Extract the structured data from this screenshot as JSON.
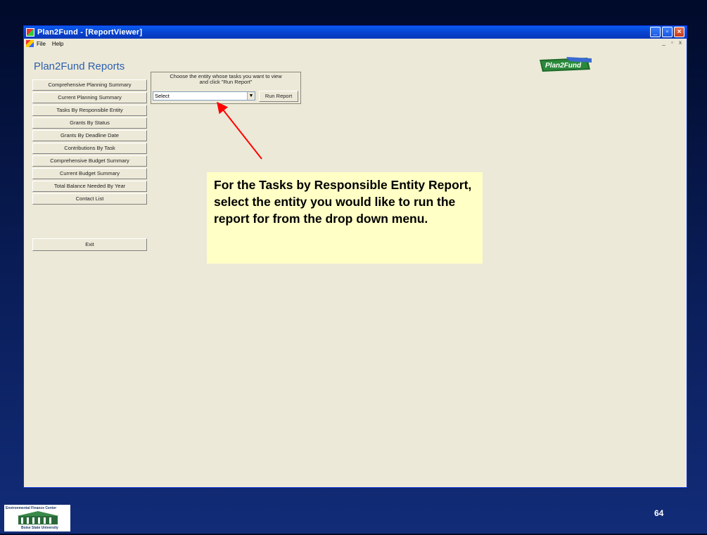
{
  "window": {
    "title": "Plan2Fund - [ReportViewer]",
    "controls": [
      "minimize",
      "restore",
      "close"
    ]
  },
  "menu": {
    "items": [
      "File",
      "Help"
    ],
    "mdi_controls": "_ ▫ x"
  },
  "app": {
    "heading": "Plan2Fund Reports",
    "brand_logo": "Plan2Fund",
    "reports": [
      "Comprehensive Planning Summary",
      "Current Planning Summary",
      "Tasks By Responsible Entity",
      "Grants By Status",
      "Grants By Deadline Date",
      "Contributions By Task",
      "Comprehensive Budget Summary",
      "Current Budget Summary",
      "Total Balance Needed By Year",
      "Contact List"
    ],
    "exit_label": "Exit",
    "selector": {
      "instruction_line1": "Choose the entity whose tasks you want to view",
      "instruction_line2": "and click \"Run Report\"",
      "dropdown_value": "Select",
      "run_label": "Run Report"
    }
  },
  "callout": {
    "text": "For the Tasks by Responsible Entity Report, select the entity you would like to run the report for from the drop down menu."
  },
  "footer": {
    "logo_top": "Environmental Finance Center",
    "logo_bottom": "Boise State University",
    "page_number": "64"
  },
  "colors": {
    "title_bar": "#0843d0",
    "window_bg": "#ece9d8",
    "heading": "#2d5fae",
    "callout_bg": "#ffffc6",
    "arrow": "#ff0000"
  }
}
